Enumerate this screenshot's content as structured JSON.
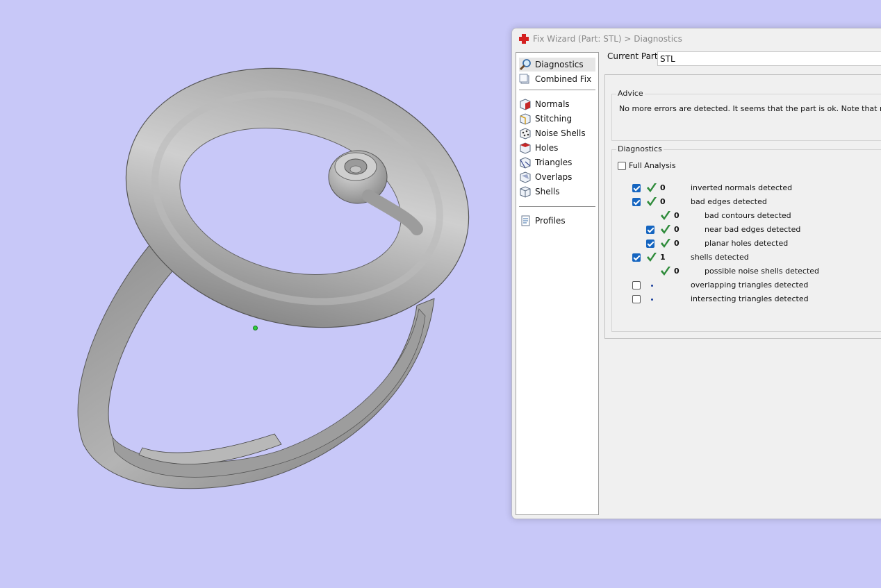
{
  "colors": {
    "viewport_bg": "#c8c8f8",
    "check_green": "#2e8b3a",
    "checkbox_blue": "#1565c0"
  },
  "window": {
    "title": "Fix Wizard (Part: STL) > Diagnostics",
    "icon": "red-cross-icon"
  },
  "nav": {
    "items": [
      {
        "label": "Diagnostics",
        "icon": "magnifier-icon",
        "selected": true
      },
      {
        "label": "Combined Fix",
        "icon": "combined-fix-icon"
      },
      {
        "label": "Normals",
        "icon": "normals-cube-icon"
      },
      {
        "label": "Stitching",
        "icon": "stitching-cube-icon"
      },
      {
        "label": "Noise Shells",
        "icon": "noise-shells-icon"
      },
      {
        "label": "Holes",
        "icon": "holes-cube-icon"
      },
      {
        "label": "Triangles",
        "icon": "triangles-cube-icon"
      },
      {
        "label": "Overlaps",
        "icon": "overlaps-cube-icon"
      },
      {
        "label": "Shells",
        "icon": "shells-cube-icon"
      },
      {
        "label": "Profiles",
        "icon": "document-icon"
      }
    ]
  },
  "current_part": {
    "label": "Current Part:",
    "value": "STL"
  },
  "advice": {
    "title": "Advice",
    "text": "No more errors are detected. It seems that the part is ok. Note that not all par"
  },
  "diagnostics": {
    "title": "Diagnostics",
    "full_analysis": {
      "label": "Full Analysis",
      "checked": false
    },
    "rows": [
      {
        "checkbox": true,
        "checked": true,
        "status": "ok",
        "count": "0",
        "label": "inverted normals detected",
        "indent": 0
      },
      {
        "checkbox": true,
        "checked": true,
        "status": "ok",
        "count": "0",
        "label": "bad edges detected",
        "indent": 0
      },
      {
        "checkbox": false,
        "checked": false,
        "status": "ok",
        "count": "0",
        "label": "bad contours detected",
        "indent": 1
      },
      {
        "checkbox": true,
        "checked": true,
        "status": "ok",
        "count": "0",
        "label": "near bad edges detected",
        "indent": 1
      },
      {
        "checkbox": true,
        "checked": true,
        "status": "ok",
        "count": "0",
        "label": "planar holes detected",
        "indent": 1
      },
      {
        "checkbox": true,
        "checked": true,
        "status": "ok",
        "count": "1",
        "label": "shells detected",
        "indent": 0
      },
      {
        "checkbox": false,
        "checked": false,
        "status": "ok",
        "count": "0",
        "label": "possible noise shells detected",
        "indent": 1
      },
      {
        "checkbox": true,
        "checked": false,
        "status": "pending",
        "count": "",
        "label": "overlapping triangles detected",
        "indent": 0
      },
      {
        "checkbox": true,
        "checked": false,
        "status": "pending",
        "count": "",
        "label": "intersecting triangles detected",
        "indent": 0
      }
    ]
  }
}
